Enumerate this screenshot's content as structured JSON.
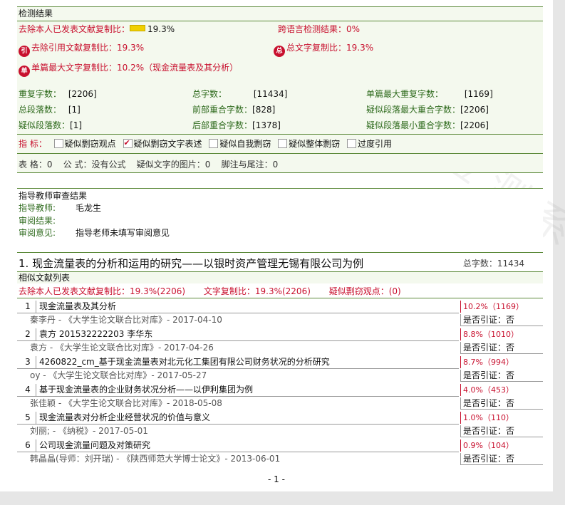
{
  "s1": {
    "header": "检测结果",
    "excl_self_label": "去除本人已发表文献复制比：",
    "excl_self_value": "19.3%",
    "cross_lang": "跨语言检测结果：0%",
    "excl_cite_icon": "引",
    "excl_cite": "去除引用文献复制比：19.3%",
    "total_copy_icon": "总",
    "total_copy": "总文字复制比：19.3%",
    "single_max_icon": "单",
    "single_max": "单篇最大文字复制比：10.2%（现金流量表及其分析）",
    "stats": [
      {
        "label": "重复字数：",
        "value": "[2206]"
      },
      {
        "label": "总字数：",
        "value": "[11434]"
      },
      {
        "label": "单篇最大重复字数：",
        "value": "[1169]"
      },
      {
        "label": "总段落数：",
        "value": "[1]"
      },
      {
        "label": "前部重合字数：",
        "value": "[828]"
      },
      {
        "label": "疑似段落最大重合字数：",
        "value": "[2206]"
      },
      {
        "label": "疑似段落数：",
        "value": "[1]"
      },
      {
        "label": "后部重合字数：",
        "value": "[1378]"
      },
      {
        "label": "疑似段落最小重合字数：",
        "value": "[2206]"
      }
    ],
    "indicator_label": "指  标：",
    "indicators": [
      {
        "label": "疑似剽窃观点",
        "checked": false
      },
      {
        "label": "疑似剽窃文字表述",
        "checked": true
      },
      {
        "label": "疑似自我剽窃",
        "checked": false
      },
      {
        "label": "疑似整体剽窃",
        "checked": false
      },
      {
        "label": "过度引用",
        "checked": false
      }
    ],
    "misc": "表 格：0    公 式：没有公式    疑似文字的图片：0    脚注与尾注：0"
  },
  "s2": {
    "header": "指导教师审查结果",
    "teacher_label": "指导教师:",
    "teacher_value": "毛龙生",
    "review_result_label": "审阅结果:",
    "review_opinion_label": "审阅意见:",
    "review_opinion_value": "指导老师未填写审阅意见"
  },
  "s3": {
    "title": "1. 现金流量表的分析和运用的研究——以银时资产管理无锡有限公司为例",
    "total": "总字数：11434",
    "sub_header": "相似文献列表",
    "sum_excl": "去除本人已发表文献复制比：19.3%(2206)",
    "sum_copy": "文字复制比：19.3%(2206)",
    "sum_plag": "疑似剽窃观点：(0)",
    "items": [
      {
        "num": "1",
        "title": "现金流量表及其分析",
        "author": "秦李丹 - 《大学生论文联合比对库》- 2017-04-10",
        "pct": "10.2%（1169）",
        "cite": "是否引证：否"
      },
      {
        "num": "2",
        "title": "袁方 201532222203 李华东",
        "author": "袁方 - 《大学生论文联合比对库》- 2017-04-26",
        "pct": "8.8%（1010）",
        "cite": "是否引证：否"
      },
      {
        "num": "3",
        "title": "4260822_cm_基于现金流量表对北元化工集团有限公司财务状况的分析研究",
        "author": "oy - 《大学生论文联合比对库》- 2017-05-27",
        "pct": "8.7%（994）",
        "cite": "是否引证：否"
      },
      {
        "num": "4",
        "title": "基于现金流量表的企业财务状况分析——以伊利集团为例",
        "author": "张佳颖 - 《大学生论文联合比对库》- 2018-05-08",
        "pct": "4.0%（453）",
        "cite": "是否引证：否"
      },
      {
        "num": "5",
        "title": "现金流量表对分析企业经营状况的价值与意义",
        "author": "刘丽; - 《纳税》- 2017-05-01",
        "pct": "1.0%（110）",
        "cite": "是否引证：否"
      },
      {
        "num": "6",
        "title": "公司现金流量问题及对策研究",
        "author": "韩晶晶(导师：刘开瑞) - 《陕西师范大学博士论文》- 2013-06-01",
        "pct": "0.9%（104）",
        "cite": "是否引证：否"
      }
    ]
  },
  "page_number": "- 1 -"
}
